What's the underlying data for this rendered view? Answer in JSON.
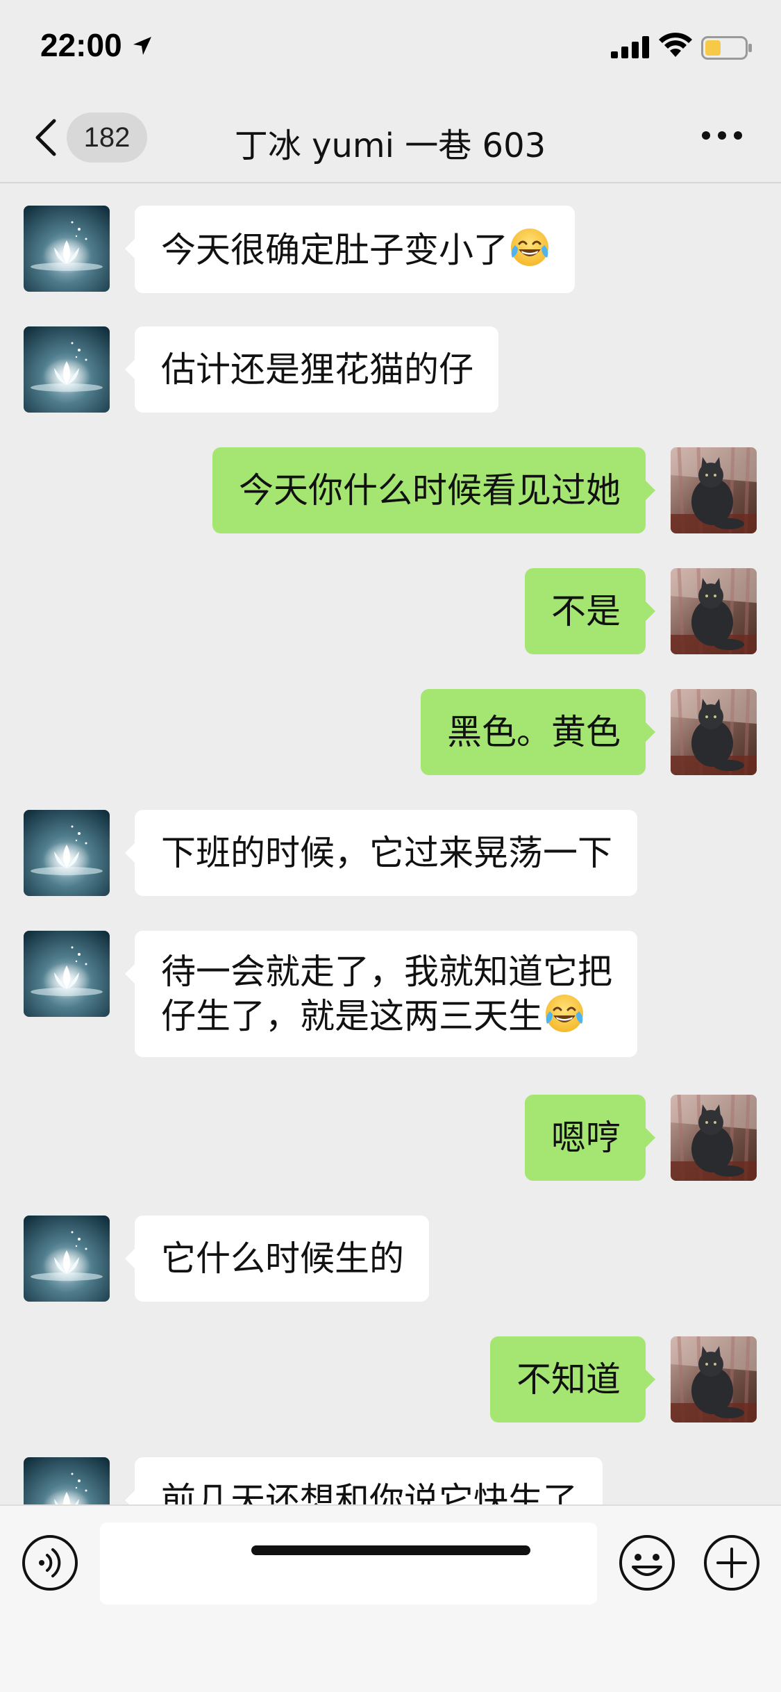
{
  "status_bar": {
    "time": "22:00"
  },
  "header": {
    "unread_count": "182",
    "title": "丁冰 yumi 一巷 603"
  },
  "messages": [
    {
      "side": "in",
      "text": "今天很确定肚子变小了",
      "emoji": "face-with-tears-of-joy"
    },
    {
      "side": "in",
      "text": "估计还是狸花猫的仔"
    },
    {
      "side": "out",
      "text": "今天你什么时候看见过她"
    },
    {
      "side": "out",
      "text": "不是"
    },
    {
      "side": "out",
      "text": "黑色。黄色"
    },
    {
      "side": "in",
      "text": "下班的时候，它过来晃荡一下"
    },
    {
      "side": "in",
      "line1": "待一会就走了，我就知道它把",
      "line2": "仔生了，就是这两三天生",
      "emoji": "face-with-tears-of-joy"
    },
    {
      "side": "out",
      "text": "嗯哼"
    },
    {
      "side": "in",
      "text": "它什么时候生的"
    },
    {
      "side": "out",
      "text": "不知道"
    },
    {
      "side": "in",
      "text": "前几天还想和你说它快生了"
    }
  ],
  "input": {
    "value": "",
    "placeholder": ""
  },
  "colors": {
    "background": "#ededed",
    "incoming_bubble": "#ffffff",
    "outgoing_bubble": "#a5e673",
    "battery_level": "#f7c948"
  }
}
